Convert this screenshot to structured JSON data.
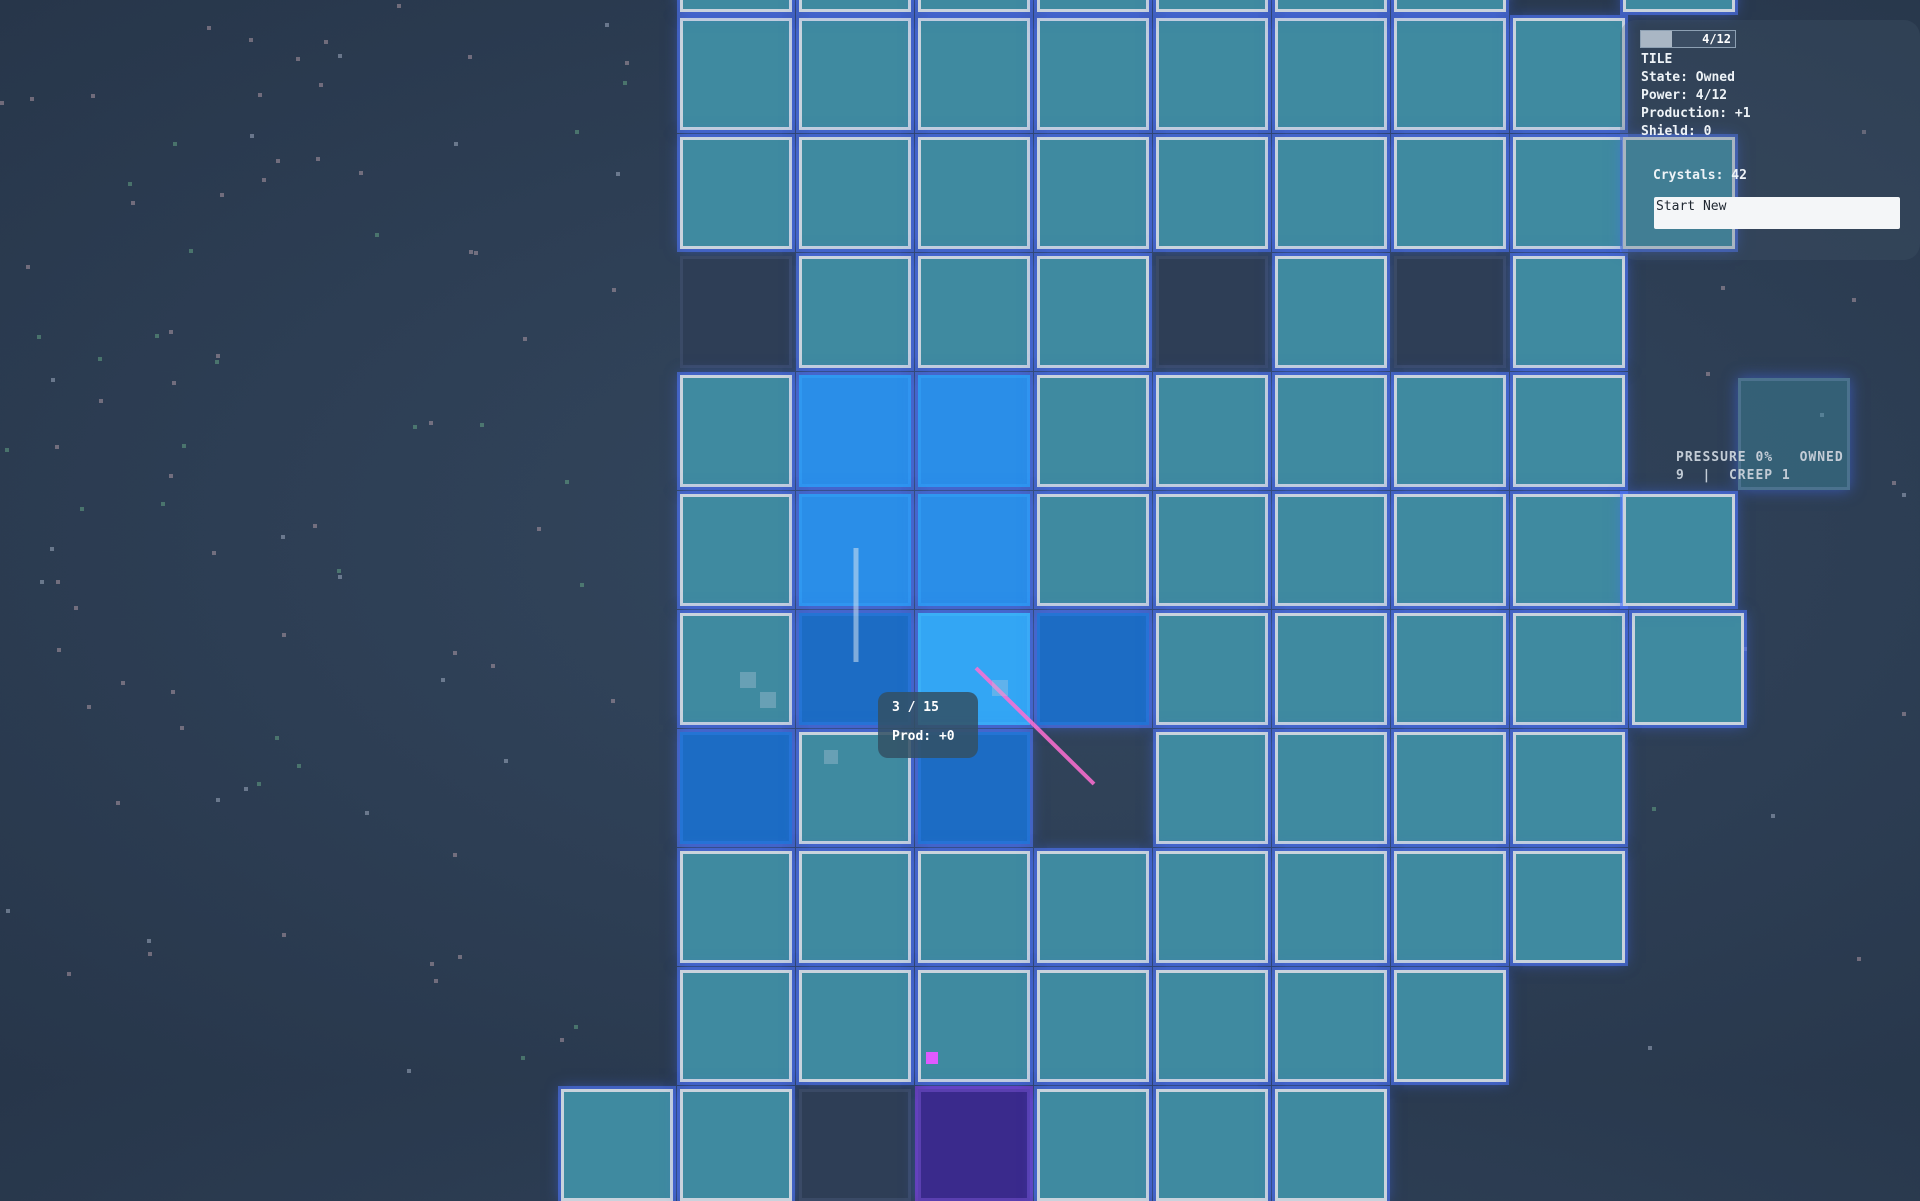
{
  "hud": {
    "power_bar_text": "4/12",
    "power_fraction": 0.333,
    "tile_title": "TILE",
    "state": "State: Owned",
    "power": "Power: 4/12",
    "production": "Production: +1",
    "shield": "Shield: 0",
    "crystals": "Crystals: 42",
    "start_new_label": "Start New"
  },
  "status": {
    "line1": "PRESSURE 0%   OWNED",
    "line2": "9  |  CREEP 1"
  },
  "tooltip": {
    "count": "3 / 15",
    "prod": "Prod: +0"
  },
  "colors": {
    "owned": "#3f8aa0",
    "selected": "#2a8ee8",
    "creep": "#3a2a8c",
    "background": "#2d3e54"
  },
  "board": {
    "rows": [
      "-OOOOOOOO",
      "-OOOOOOOO",
      "-.OOO.O.O",
      "-OSSOOOOO",
      "-OSSOOOOO",
      "-ODLDOOOOO",
      "-DOD-OOOO",
      "-OOOOOOOO",
      "-OOOOOOO",
      "OO.POOO"
    ]
  }
}
